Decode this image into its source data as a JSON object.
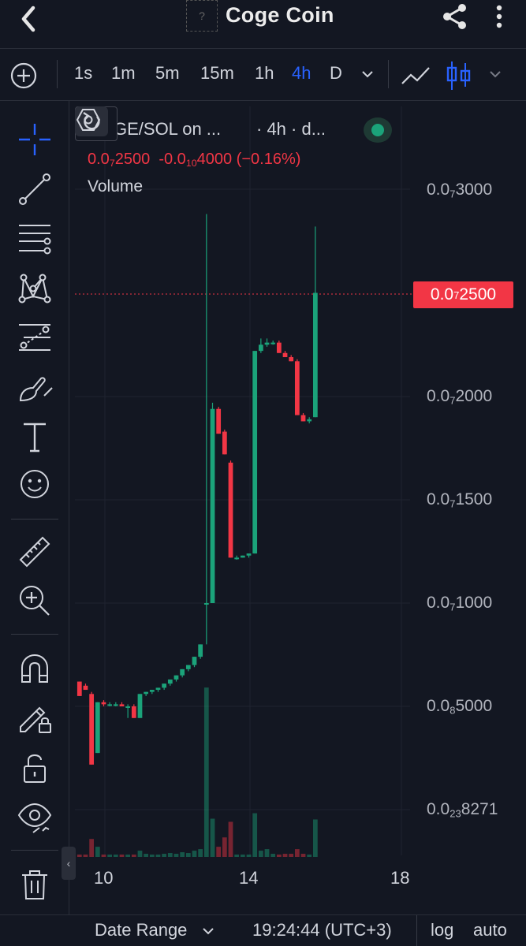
{
  "header": {
    "title": "Coge Coin",
    "logo_placeholder": "?"
  },
  "toolbar": {
    "timeframes": [
      "1s",
      "1m",
      "5m",
      "15m",
      "1h",
      "4h",
      "D"
    ],
    "active_timeframe": "4h"
  },
  "legend": {
    "symbol": "COGE/SOL on ...",
    "interval": "· 4h · d...",
    "price": {
      "prefix": "0.0",
      "zeros": "7",
      "digits": "2500"
    },
    "change": {
      "prefix": "-0.0",
      "zeros": "10",
      "digits": "4000"
    },
    "change_percent": "(−0.16%)",
    "volume_label": "Volume"
  },
  "price_scale": [
    {
      "prefix": "0.0",
      "zeros": "7",
      "digits": "3000"
    },
    {
      "prefix": "0.0",
      "zeros": "7",
      "digits": "2000"
    },
    {
      "prefix": "0.0",
      "zeros": "7",
      "digits": "1500"
    },
    {
      "prefix": "0.0",
      "zeros": "7",
      "digits": "1000"
    },
    {
      "prefix": "0.0",
      "zeros": "8",
      "digits": "5000"
    },
    {
      "prefix": "0.0",
      "zeros": "23",
      "digits": "8271"
    }
  ],
  "last_price": {
    "prefix": "0.0",
    "zeros": "7",
    "digits": "2500"
  },
  "time_scale": [
    "10",
    "14",
    "18"
  ],
  "bottom_bar": {
    "date_range": "Date Range",
    "clock": "19:24:44 (UTC+3)",
    "log": "log",
    "auto": "auto"
  },
  "colors": {
    "up": "#1ba37a",
    "down": "#f23645",
    "accent": "#2962ff",
    "background": "#131722"
  },
  "chart_data": {
    "type": "candlestick",
    "price_unit_label": "× 1e-8 SOL",
    "candles": [
      {
        "o": 0.62,
        "h": 0.62,
        "l": 0.55,
        "c": 0.55
      },
      {
        "o": 0.6,
        "h": 0.61,
        "l": 0.58,
        "c": 0.58
      },
      {
        "o": 0.56,
        "h": 0.57,
        "l": 0.45,
        "c": 0.45
      },
      {
        "o": 0.46,
        "h": 0.52,
        "l": 0.46,
        "c": 0.52
      },
      {
        "o": 0.52,
        "h": 0.53,
        "l": 0.5,
        "c": 0.51
      },
      {
        "o": 0.51,
        "h": 0.52,
        "l": 0.5,
        "c": 0.51
      },
      {
        "o": 0.51,
        "h": 0.52,
        "l": 0.5,
        "c": 0.51
      },
      {
        "o": 0.51,
        "h": 0.52,
        "l": 0.5,
        "c": 0.5
      },
      {
        "o": 0.5,
        "h": 0.51,
        "l": 0.49,
        "c": 0.5
      },
      {
        "o": 0.5,
        "h": 0.51,
        "l": 0.49,
        "c": 0.49
      },
      {
        "o": 0.49,
        "h": 0.56,
        "l": 0.49,
        "c": 0.56
      },
      {
        "o": 0.56,
        "h": 0.57,
        "l": 0.55,
        "c": 0.57
      },
      {
        "o": 0.57,
        "h": 0.58,
        "l": 0.56,
        "c": 0.58
      },
      {
        "o": 0.58,
        "h": 0.59,
        "l": 0.57,
        "c": 0.59
      },
      {
        "o": 0.59,
        "h": 0.61,
        "l": 0.58,
        "c": 0.61
      },
      {
        "o": 0.61,
        "h": 0.63,
        "l": 0.6,
        "c": 0.63
      },
      {
        "o": 0.63,
        "h": 0.65,
        "l": 0.62,
        "c": 0.65
      },
      {
        "o": 0.65,
        "h": 0.68,
        "l": 0.64,
        "c": 0.68
      },
      {
        "o": 0.68,
        "h": 0.7,
        "l": 0.67,
        "c": 0.7
      },
      {
        "o": 0.7,
        "h": 0.74,
        "l": 0.69,
        "c": 0.74
      },
      {
        "o": 0.74,
        "h": 0.8,
        "l": 0.73,
        "c": 0.8
      },
      {
        "o": 1.0,
        "h": 2.88,
        "l": 0.8,
        "c": 1.0
      },
      {
        "o": 1.0,
        "h": 1.97,
        "l": 1.0,
        "c": 1.94
      },
      {
        "o": 1.94,
        "h": 1.95,
        "l": 1.82,
        "c": 1.82
      },
      {
        "o": 1.83,
        "h": 1.84,
        "l": 1.72,
        "c": 1.72
      },
      {
        "o": 1.68,
        "h": 1.69,
        "l": 1.22,
        "c": 1.22
      },
      {
        "o": 1.22,
        "h": 1.23,
        "l": 1.21,
        "c": 1.22
      },
      {
        "o": 1.22,
        "h": 1.23,
        "l": 1.22,
        "c": 1.23
      },
      {
        "o": 1.23,
        "h": 1.24,
        "l": 1.22,
        "c": 1.24
      },
      {
        "o": 1.24,
        "h": 2.22,
        "l": 1.24,
        "c": 2.22
      },
      {
        "o": 2.22,
        "h": 2.28,
        "l": 2.21,
        "c": 2.25
      },
      {
        "o": 2.25,
        "h": 2.28,
        "l": 2.24,
        "c": 2.26
      },
      {
        "o": 2.26,
        "h": 2.27,
        "l": 2.25,
        "c": 2.26
      },
      {
        "o": 2.26,
        "h": 2.27,
        "l": 2.21,
        "c": 2.21
      },
      {
        "o": 2.21,
        "h": 2.22,
        "l": 2.19,
        "c": 2.19
      },
      {
        "o": 2.19,
        "h": 2.2,
        "l": 2.17,
        "c": 2.17
      },
      {
        "o": 2.17,
        "h": 2.18,
        "l": 1.91,
        "c": 1.91
      },
      {
        "o": 1.91,
        "h": 1.92,
        "l": 1.88,
        "c": 1.88
      },
      {
        "o": 1.88,
        "h": 1.9,
        "l": 1.87,
        "c": 1.89
      },
      {
        "o": 1.9,
        "h": 2.82,
        "l": 1.9,
        "c": 2.5
      }
    ],
    "volumes": [
      0.3,
      0.3,
      2.3,
      1.3,
      0.3,
      0.3,
      0.3,
      0.3,
      0.3,
      0.3,
      0.8,
      0.4,
      0.3,
      0.3,
      0.4,
      0.5,
      0.4,
      0.6,
      0.5,
      0.8,
      1.0,
      21.7,
      4.9,
      1.3,
      2.5,
      4.5,
      0.3,
      0.3,
      0.3,
      5.6,
      0.8,
      1.0,
      0.4,
      0.3,
      0.4,
      0.4,
      1.0,
      0.4,
      0.3,
      4.8
    ],
    "x_start_day": 9.3,
    "candle_step_days": 0.1667
  }
}
